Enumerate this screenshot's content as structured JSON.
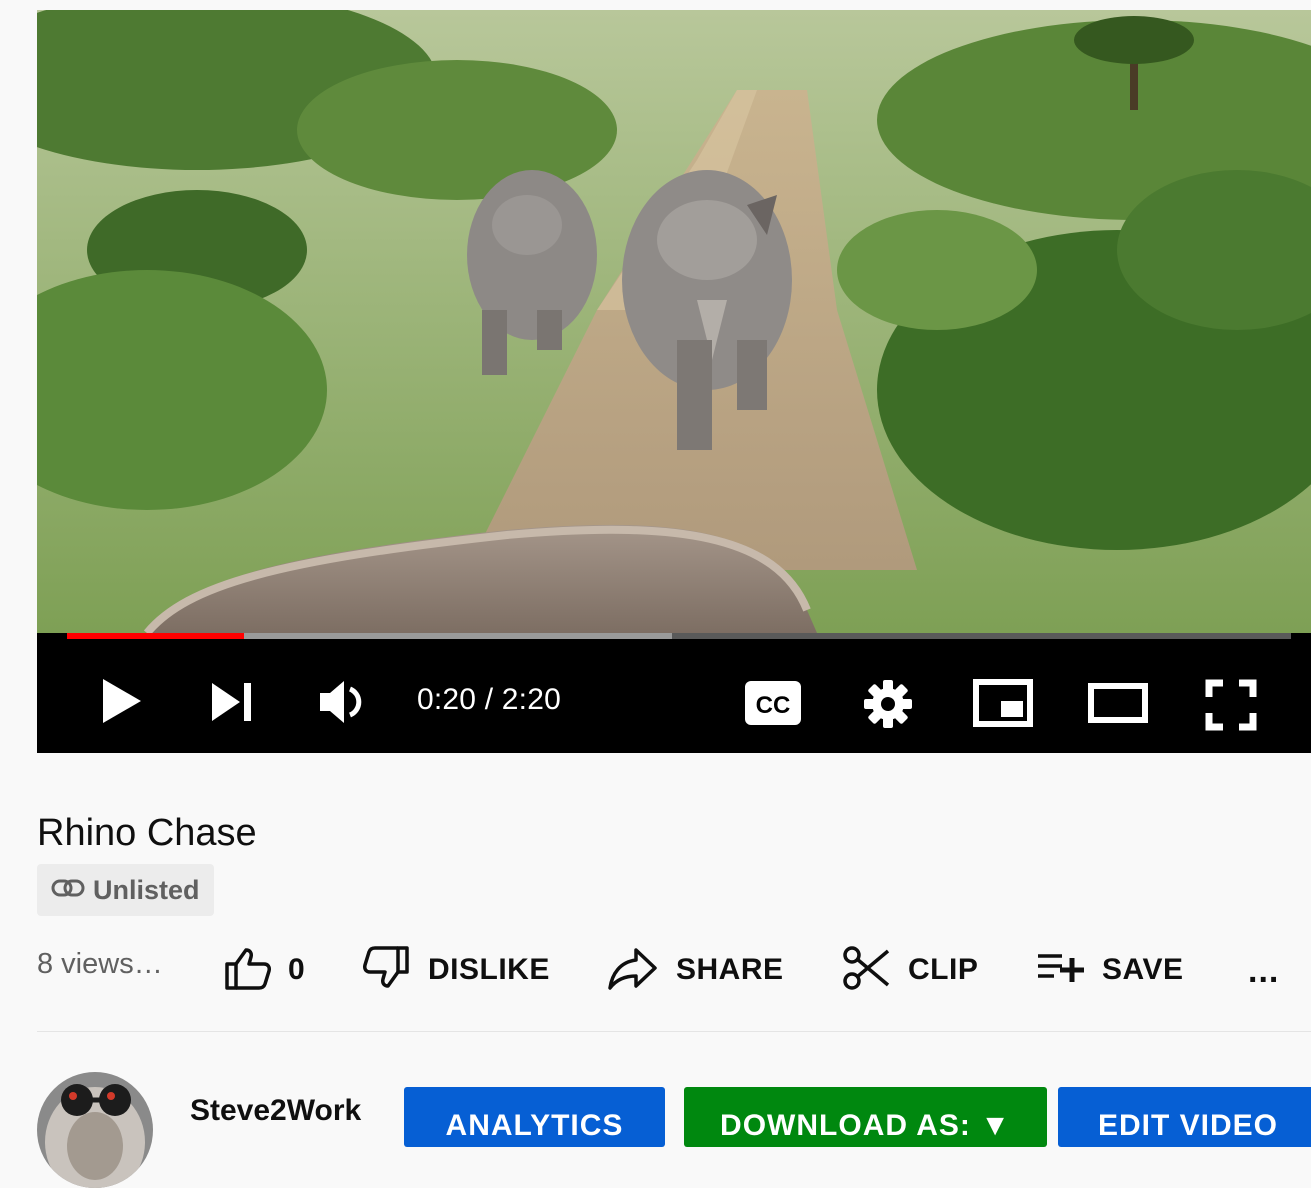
{
  "player": {
    "current_time": "0:20",
    "duration": "2:20",
    "time_display": "0:20 / 2:20",
    "progress_played": 0.145,
    "progress_buffered": 0.494,
    "controls": {
      "play": "play-icon",
      "next": "next-icon",
      "volume": "volume-icon",
      "captions": "cc-icon",
      "captions_label": "CC",
      "settings": "gear-icon",
      "miniplayer": "miniplayer-icon",
      "theater": "theater-icon",
      "fullscreen": "fullscreen-icon"
    }
  },
  "video": {
    "title": "Rhino Chase",
    "visibility": "Unlisted",
    "views": "8 views…"
  },
  "actions": {
    "like_count": "0",
    "dislike": "DISLIKE",
    "share": "SHARE",
    "clip": "CLIP",
    "save": "SAVE",
    "more": "..."
  },
  "channel": {
    "name": "Steve2Work"
  },
  "buttons": {
    "analytics": "ANALYTICS",
    "download": "DOWNLOAD AS: ▼",
    "edit": "EDIT VIDEO"
  },
  "colors": {
    "progress_played": "#ff0000",
    "analytics_button": "#065fd4",
    "download_button": "#00880f",
    "edit_button": "#065fd4"
  }
}
